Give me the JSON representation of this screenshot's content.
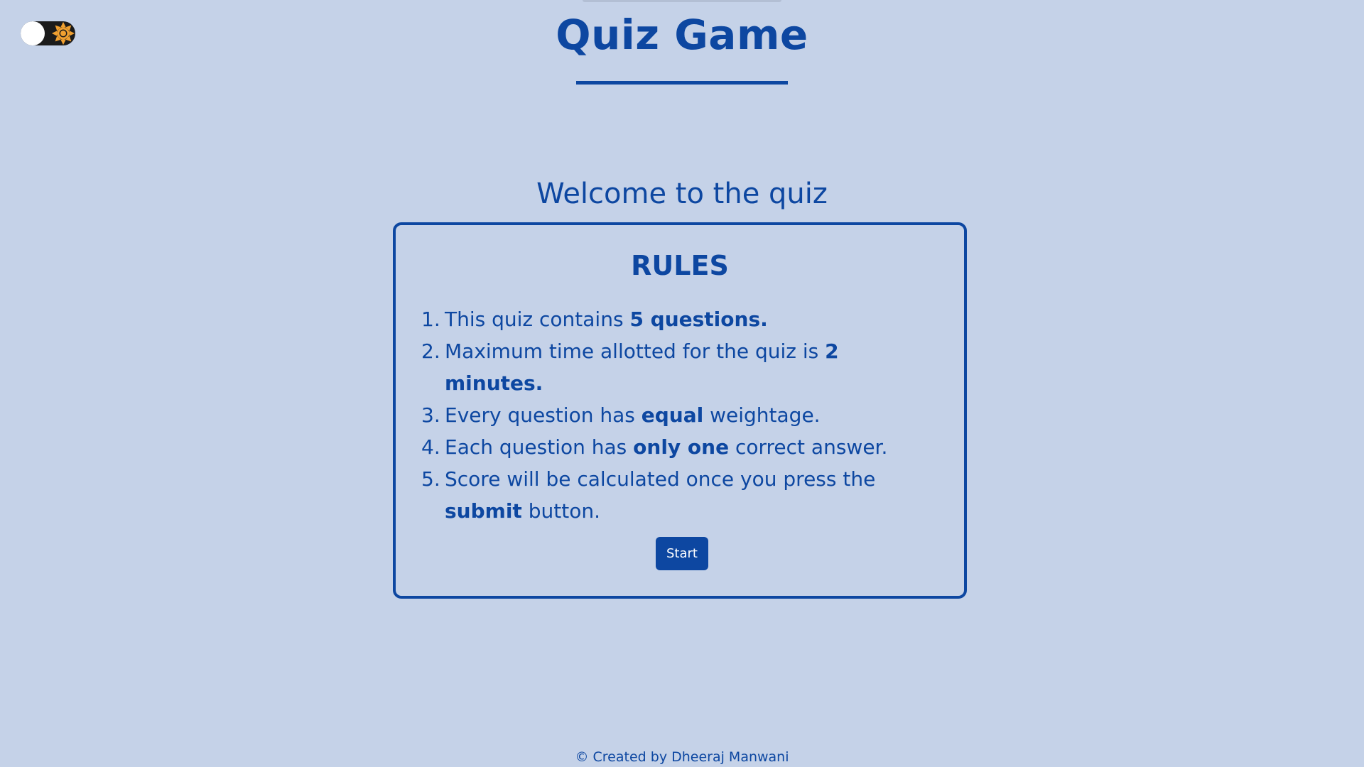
{
  "header": {
    "title": "Quiz Game"
  },
  "theme_toggle": {
    "icon": "sun-icon",
    "state": "light",
    "icon_color": "#f0a030"
  },
  "main": {
    "welcome": "Welcome to the quiz",
    "rules": {
      "title": "RULES",
      "items": [
        {
          "num": "1.",
          "before": "This quiz contains ",
          "bold": "5 questions.",
          "after": ""
        },
        {
          "num": "2.",
          "before": "Maximum time allotted for the quiz is ",
          "bold": "2 minutes.",
          "after": ""
        },
        {
          "num": "3.",
          "before": "Every question has ",
          "bold": "equal",
          "after": " weightage."
        },
        {
          "num": "4.",
          "before": "Each question has ",
          "bold": "only one",
          "after": " correct answer."
        },
        {
          "num": "5.",
          "before": "Score will be calculated once you press the ",
          "bold": "submit",
          "after": " button."
        }
      ]
    },
    "start_label": "Start"
  },
  "footer": {
    "text": "© Created by Dheeraj Manwani"
  },
  "colors": {
    "background": "#c5d2e8",
    "accent": "#0d47a1",
    "button_text": "#ffffff"
  }
}
